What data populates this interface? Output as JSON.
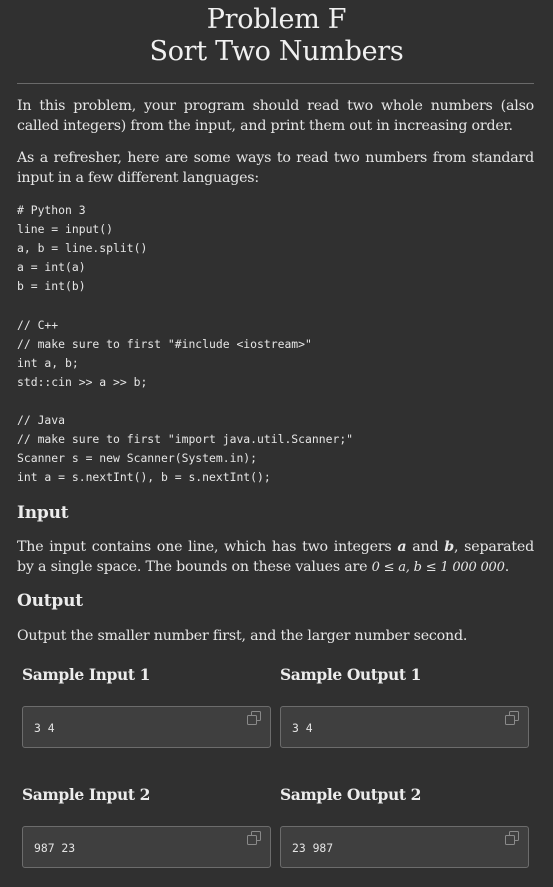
{
  "title": {
    "line1": "Problem F",
    "line2": "Sort Two Numbers"
  },
  "intro": {
    "p1": "In this problem, your program should read two whole numbers (also called integers) from the input, and print them out in increasing order.",
    "p2": "As a refresher, here are some ways to read two numbers from standard input in a few different languages:"
  },
  "code_lines": [
    "# Python 3",
    "line = input()",
    "a, b = line.split()",
    "a = int(a)",
    "b = int(b)",
    "",
    "// C++",
    "// make sure to first \"#include <iostream>\"",
    "int a, b;",
    "std::cin >> a >> b;",
    "",
    "// Java",
    "// make sure to first \"import java.util.Scanner;\"",
    "Scanner s = new Scanner(System.in);",
    "int a = s.nextInt(), b = s.nextInt();"
  ],
  "input_section": {
    "heading": "Input",
    "text_before": "The input contains one line, which has two integers ",
    "var_a": "a",
    "text_and": " and ",
    "var_b": "b",
    "text_after": ", separated by a single space. The bounds on these values are ",
    "bounds": "0 ≤ a, b ≤ 1 000 000",
    "text_end": "."
  },
  "output_section": {
    "heading": "Output",
    "text": "Output the smaller number first, and the larger number second."
  },
  "samples": [
    {
      "input_label": "Sample Input 1",
      "input_value": "3 4",
      "output_label": "Sample Output 1",
      "output_value": "3 4"
    },
    {
      "input_label": "Sample Input 2",
      "input_value": "987 23",
      "output_label": "Sample Output 2",
      "output_value": "23 987"
    }
  ],
  "icons": {
    "copy": "copy-icon"
  }
}
